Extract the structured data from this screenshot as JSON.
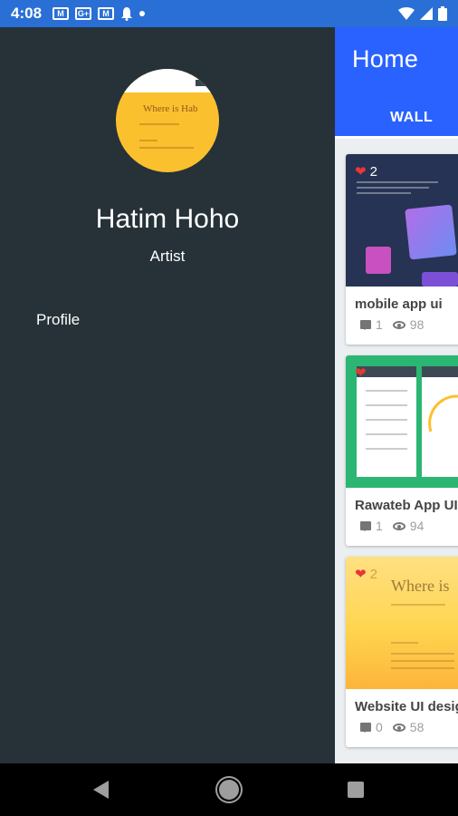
{
  "status_bar": {
    "time": "4:08",
    "icons": [
      "gmail-icon",
      "google-plus-icon",
      "gmail-icon",
      "notification-bell-icon",
      "dot-icon"
    ],
    "right_icons": [
      "wifi-icon",
      "signal-icon",
      "battery-icon"
    ]
  },
  "app": {
    "title": "Home",
    "tab": "WALL",
    "colors": {
      "primary": "#2962ff",
      "drawer_bg": "#263238"
    },
    "posts": [
      {
        "title": "mobile app ui",
        "likes": "2",
        "comments": "1",
        "views": "98"
      },
      {
        "title": "Rawateb App UI",
        "likes": "",
        "comments": "1",
        "views": "94"
      },
      {
        "title": "Website UI design",
        "likes": "2",
        "comments": "0",
        "views": "58",
        "thumb_text": "Where is"
      }
    ]
  },
  "drawer": {
    "name": "Hatim Hoho",
    "role": "Artist",
    "items": [
      {
        "label": "Profile"
      }
    ],
    "avatar_text": "Where is Hab"
  },
  "nav": {
    "buttons": [
      "back-icon",
      "home-icon",
      "recents-icon"
    ]
  }
}
